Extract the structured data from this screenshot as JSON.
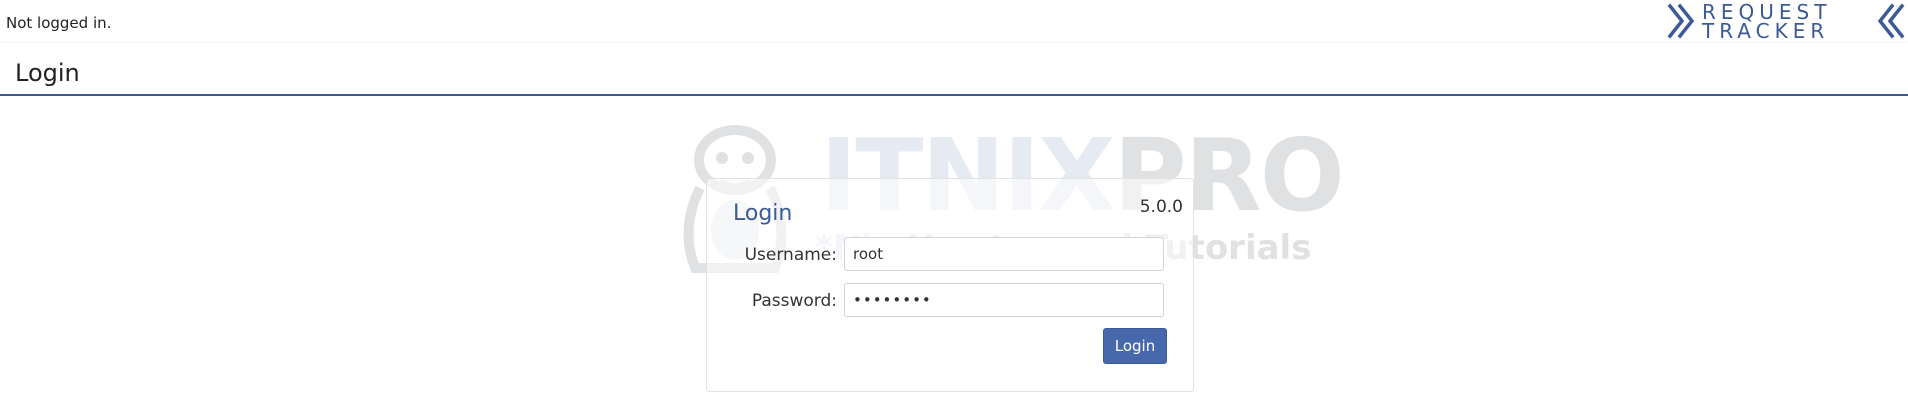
{
  "header": {
    "login_status": "Not logged in.",
    "logo_line1": "REQUEST",
    "logo_line2": "TRACKER",
    "logo_color": "#3c5a96"
  },
  "page": {
    "title": "Login"
  },
  "watermark": {
    "brand_part1": "ITNIX",
    "brand_part2": "PRO",
    "tagline_part1": "*Nix",
    "tagline_part2": " Howtos and Tutorials"
  },
  "login_form": {
    "title": "Login",
    "version": "5.0.0",
    "username_label": "Username:",
    "username_value": "root",
    "password_label": "Password:",
    "password_value": "••••••••",
    "submit_label": "Login",
    "accent_color": "#4868ac"
  }
}
